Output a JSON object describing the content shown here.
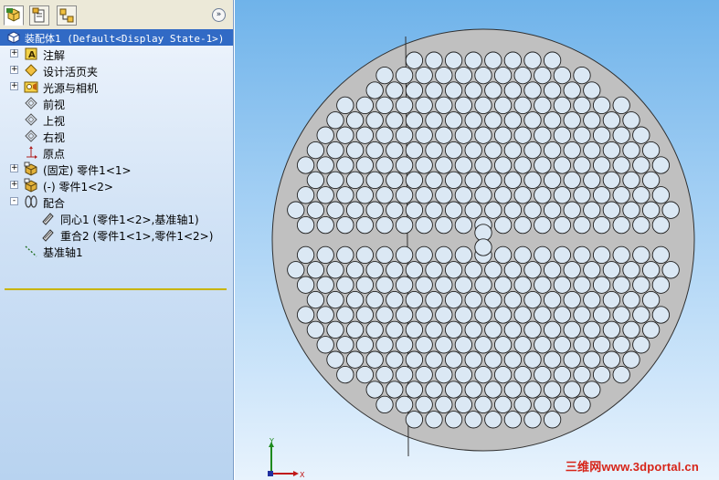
{
  "tabs": [
    {
      "name": "feature-manager",
      "icon": "feature-tree-icon"
    },
    {
      "name": "property-manager",
      "icon": "property-icon"
    },
    {
      "name": "configuration-manager",
      "icon": "configuration-icon"
    }
  ],
  "chevron_label": "»",
  "tree": {
    "root": "装配体1  (Default<Display State-1>)",
    "items": [
      {
        "label": "注解",
        "icon": "annotation-icon",
        "expand": "+"
      },
      {
        "label": "设计活页夹",
        "icon": "design-binder-icon",
        "expand": "+"
      },
      {
        "label": "光源与相机",
        "icon": "lights-cameras-icon",
        "expand": "+"
      },
      {
        "label": "前视",
        "icon": "plane-icon",
        "expand": ""
      },
      {
        "label": "上视",
        "icon": "plane-icon",
        "expand": ""
      },
      {
        "label": "右视",
        "icon": "plane-icon",
        "expand": ""
      },
      {
        "label": "原点",
        "icon": "origin-icon",
        "expand": ""
      },
      {
        "label": "(固定) 零件1<1>",
        "icon": "part-icon",
        "expand": "+"
      },
      {
        "label": "(-) 零件1<2>",
        "icon": "part-icon",
        "expand": "+"
      },
      {
        "label": "配合",
        "icon": "mates-icon",
        "expand": "-"
      },
      {
        "label": "同心1 (零件1<2>,基准轴1)",
        "icon": "mate-icon",
        "expand": ""
      },
      {
        "label": "重合2 (零件1<1>,零件1<2>)",
        "icon": "mate-icon",
        "expand": ""
      },
      {
        "label": "基准轴1",
        "icon": "axis-icon",
        "expand": ""
      }
    ]
  },
  "triad": {
    "y_label": "Y",
    "x_label": "X"
  },
  "watermark": "三维网www.3dportal.cn",
  "colors": {
    "selection": "#316ac5",
    "part_face": "#c0c0c0",
    "viewport_top": "#6fb3ea",
    "viewport_bottom": "#e8f3fd",
    "watermark": "#d72418"
  }
}
